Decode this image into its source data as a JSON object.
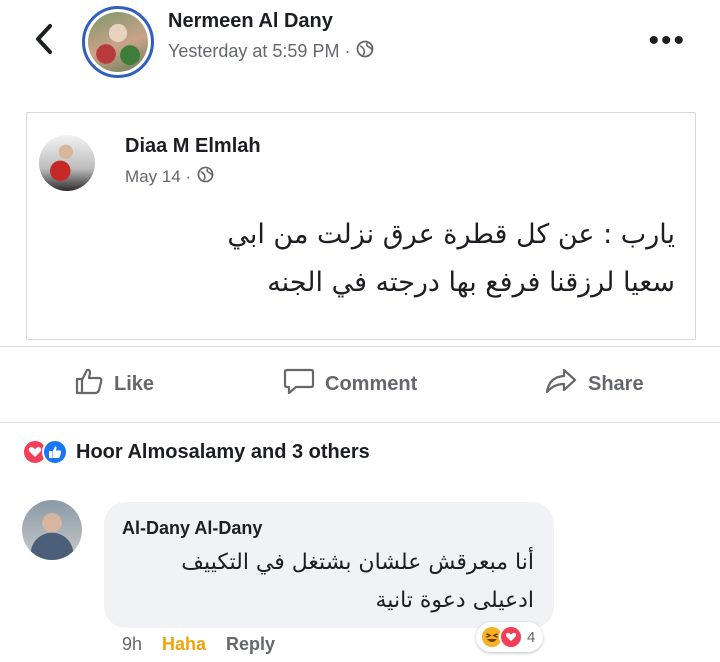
{
  "header": {
    "author": "Nermeen Al Dany",
    "timestamp": "Yesterday at 5:59 PM ·",
    "audience_icon": "globe-icon",
    "back_icon": "chevron-left-icon",
    "more_icon": "more-options-icon",
    "more_label": "•••"
  },
  "shared_post": {
    "author": "Diaa M Elmlah",
    "timestamp": "May 14 ·",
    "audience_icon": "globe-icon",
    "text_line1": "يارب : عن كل قطرة عرق نزلت من ابي",
    "text_line2": "سعيا لرزقنا فرفع بها درجته في الجنه"
  },
  "actions": {
    "like": "Like",
    "comment": "Comment",
    "share": "Share",
    "like_icon": "thumbs-up-icon",
    "comment_icon": "comment-bubble-icon",
    "share_icon": "share-arrow-icon"
  },
  "reactions": {
    "summary": "Hoor Almosalamy and 3 others",
    "icons": [
      "love-reaction-icon",
      "like-reaction-icon"
    ]
  },
  "comment": {
    "author": "Al-Dany Al-Dany",
    "text_line1": "أنا مبعرقش علشان بشتغل في التكييف",
    "text_line2": "ادعيلى دعوة تانية",
    "time": "9h",
    "reaction_label": "Haha",
    "reply_label": "Reply",
    "reaction_count": "4",
    "reaction_icons": [
      "haha-reaction-icon",
      "love-reaction-icon"
    ]
  },
  "colors": {
    "accent_blue": "#1877f2",
    "love_red": "#f33e58",
    "haha_yellow": "#f7b125",
    "muted_text": "#65676b"
  }
}
